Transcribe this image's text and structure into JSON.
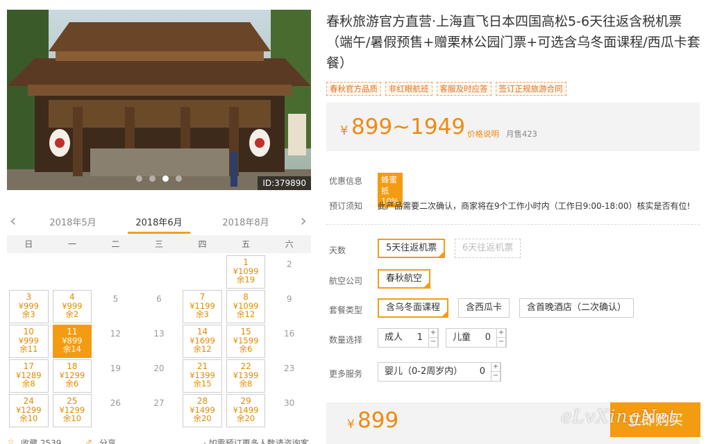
{
  "product": {
    "title": "春秋旅游官方直营·上海直飞日本四国高松5-6天往返含税机票（端午/暑假预售+赠栗林公园门票+可选含乌冬面课程/西瓜卡套餐）",
    "tags": [
      "春秋官方品质",
      "非红眼航班",
      "客服及时应答",
      "签订正规旅游合同"
    ],
    "price_yen": "¥",
    "price_range": "899~1949",
    "price_note": "价格说明",
    "monthly_sales": "月售423"
  },
  "photo": {
    "id_label": "ID:379890",
    "dots": 4,
    "active_dot": 2
  },
  "calendar": {
    "prev_month": "2018年5月",
    "current_month": "2018年6月",
    "next_month": "2018年8月",
    "weekdays": [
      "日",
      "一",
      "二",
      "三",
      "四",
      "五",
      "六"
    ],
    "weeks": [
      [
        null,
        null,
        null,
        null,
        null,
        {
          "day": "1",
          "price": "¥1099",
          "remain": "余19"
        },
        {
          "day": "2"
        }
      ],
      [
        {
          "day": "3",
          "price": "¥999",
          "remain": "余3"
        },
        {
          "day": "4",
          "price": "¥999",
          "remain": "余2"
        },
        {
          "day": "5"
        },
        {
          "day": "6"
        },
        {
          "day": "7",
          "price": "¥1199",
          "remain": "余3"
        },
        {
          "day": "8",
          "price": "¥1099",
          "remain": "余12"
        },
        {
          "day": "9"
        }
      ],
      [
        {
          "day": "10",
          "price": "¥999",
          "remain": "余11"
        },
        {
          "day": "11",
          "price": "¥899",
          "remain": "余14",
          "selected": true
        },
        {
          "day": "12"
        },
        {
          "day": "13"
        },
        {
          "day": "14",
          "price": "¥1699",
          "remain": "余12"
        },
        {
          "day": "15",
          "price": "¥1599",
          "remain": "余6"
        },
        {
          "day": "16"
        }
      ],
      [
        {
          "day": "17",
          "price": "¥1289",
          "remain": "余8"
        },
        {
          "day": "18",
          "price": "¥1299",
          "remain": "余6"
        },
        {
          "day": "19"
        },
        {
          "day": "20"
        },
        {
          "day": "21",
          "price": "¥1399",
          "remain": "余15"
        },
        {
          "day": "22",
          "price": "¥1399",
          "remain": "余8"
        },
        {
          "day": "23"
        }
      ],
      [
        {
          "day": "24",
          "price": "¥1299",
          "remain": "余10"
        },
        {
          "day": "25",
          "price": "¥1299",
          "remain": "余10"
        },
        {
          "day": "26"
        },
        {
          "day": "27"
        },
        {
          "day": "28",
          "price": "¥1499",
          "remain": "余20"
        },
        {
          "day": "29",
          "price": "¥1499",
          "remain": "余20"
        },
        {
          "day": "30"
        }
      ]
    ]
  },
  "footer": {
    "favorite": "收藏 2539",
    "share": "分享",
    "consult": "· 如需预订更多人数请咨询客服"
  },
  "promo": {
    "label": "优惠信息",
    "badge": "蜂蜜抵10%"
  },
  "booking_notice": {
    "label": "预订须知",
    "text": "此产品需要二次确认，商家将在9个工作小时内（工作日9:00-18:00）核实是否有位!"
  },
  "options": {
    "days": {
      "label": "天数",
      "items": [
        "5天往返机票",
        "6天往返机票"
      ]
    },
    "airline": {
      "label": "航空公司",
      "items": [
        "春秋航空"
      ]
    },
    "package": {
      "label": "套餐类型",
      "items": [
        "含乌冬面课程",
        "含西瓜卡",
        "含首晚酒店（二次确认）"
      ]
    },
    "quantity": {
      "label": "数量选择",
      "adult_label": "成人",
      "adult_value": "1",
      "child_label": "儿童",
      "child_value": "0"
    },
    "more": {
      "label": "更多服务",
      "infant_label": "婴儿（0-2周岁内）",
      "infant_value": "0"
    }
  },
  "total": {
    "yen": "¥",
    "value": "899"
  },
  "buy_label": "立即购买",
  "watermark": "eLvXingNet",
  "colors": {
    "accent": "#f39c12",
    "price": "#f08a10"
  }
}
